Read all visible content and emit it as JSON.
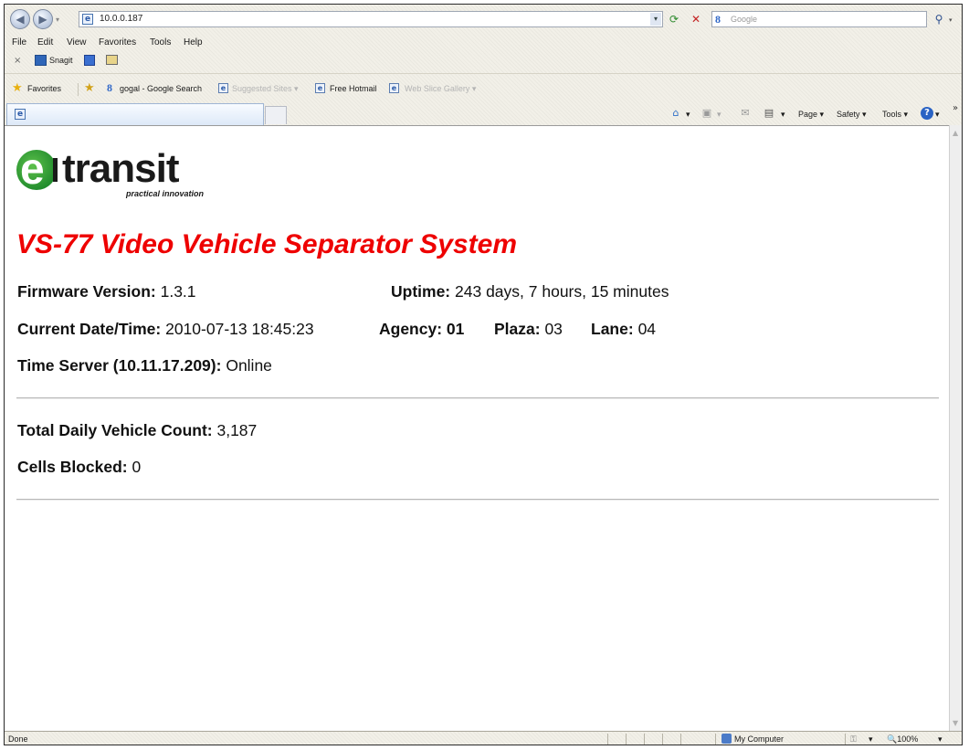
{
  "browser": {
    "address": {
      "url": "10.0.0.187",
      "dropdown_glyph": "▾"
    },
    "nav": {
      "back_glyph": "◀",
      "forward_glyph": "▶",
      "dropdown_glyph": "▾",
      "refresh_glyph": "⟳",
      "stop_glyph": "✕"
    },
    "search": {
      "provider_glyph": "8",
      "placeholder": "Google",
      "go_glyph": "⚲",
      "dropdown_glyph": "▾"
    },
    "menu": [
      "File",
      "Edit",
      "View",
      "Favorites",
      "Tools",
      "Help"
    ],
    "snagit": {
      "close_glyph": "×",
      "label": "Snagit"
    },
    "favorites": {
      "label": "Favorites",
      "links": [
        "gogal - Google Search",
        "Suggested Sites ▾",
        "Free Hotmail",
        "Web Slice Gallery ▾"
      ]
    },
    "command_bar": {
      "home_glyph": "⌂",
      "feeds_glyph": "▣",
      "mail_glyph": "✉",
      "print_glyph": "▤",
      "dropdown_glyph": "▾",
      "page": "Page ▾",
      "safety": "Safety ▾",
      "tools": "Tools ▾",
      "help_glyph": "?",
      "chevron": "»"
    },
    "status": {
      "left": "Done",
      "zone": "My Computer",
      "lock_glyph": "⚿",
      "zoom": "🔍100%",
      "zoom_dropdown": "▾"
    },
    "colors": {
      "chrome": "#f2f0e8",
      "title_red": "#ee0000",
      "logo_green": "#2e9a36"
    }
  },
  "page": {
    "logo": {
      "letter": "e",
      "word": "transit",
      "tagline": "practical innovation"
    },
    "title": "VS-77 Video Vehicle Separator System",
    "firmware": {
      "label": "Firmware Version:",
      "value": "1.3.1"
    },
    "uptime": {
      "label": "Uptime:",
      "value": "243 days, 7 hours, 15 minutes"
    },
    "datetime": {
      "label": "Current Date/Time:",
      "value": "2010-07-13 18:45:23"
    },
    "agency": {
      "label": "Agency:",
      "value": "01"
    },
    "plaza": {
      "label": "Plaza:",
      "value": "03"
    },
    "lane": {
      "label": "Lane:",
      "value": "04"
    },
    "time_server": {
      "label": "Time Server (10.11.17.209):",
      "value": "Online"
    },
    "vehicle_count": {
      "label": "Total Daily Vehicle Count:",
      "value": "3,187"
    },
    "cells_blocked": {
      "label": "Cells Blocked:",
      "value": "0"
    }
  }
}
